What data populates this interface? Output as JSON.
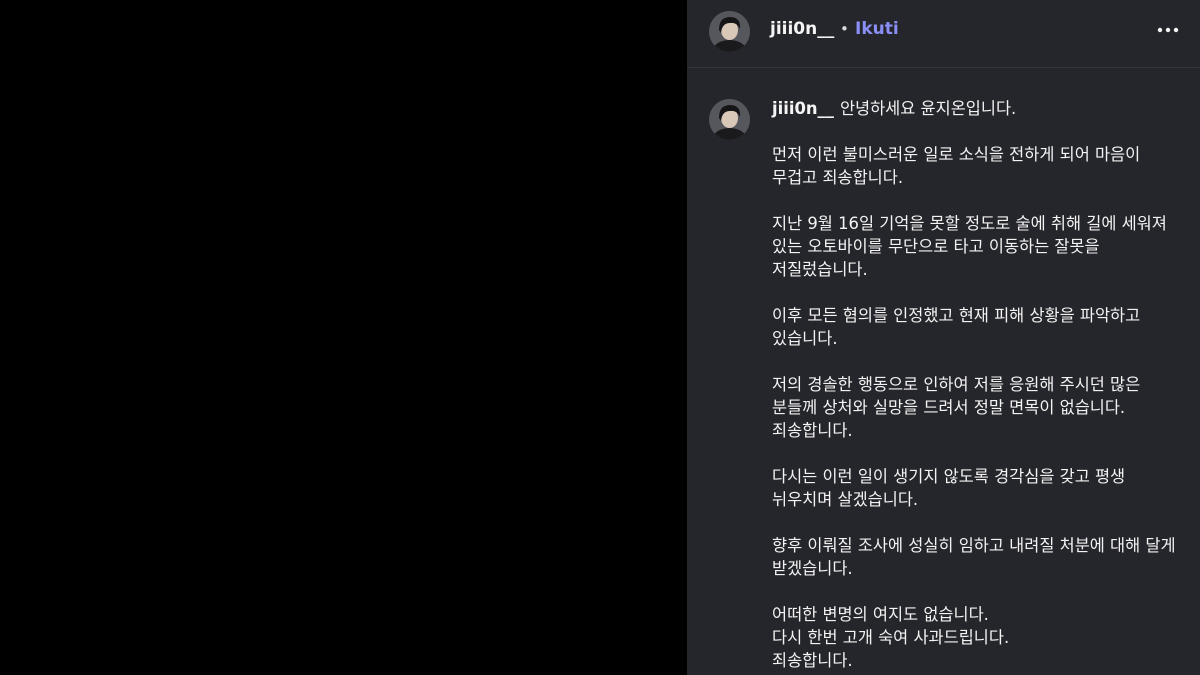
{
  "header": {
    "username": "jiii0n__",
    "separator": "•",
    "follow_label": "Ikuti",
    "avatar_icon": "profile-photo",
    "more_icon": "more-horizontal-icon"
  },
  "caption": {
    "username": "jiii0n__",
    "first_line": "안녕하세요 윤지온입니다.",
    "paragraphs": [
      "먼저 이런 불미스러운 일로 소식을 전하게 되어 마음이 무겁고 죄송합니다.",
      "지난 9월 16일 기억을 못할 정도로 술에 취해 길에 세워져 있는 오토바이를 무단으로 타고 이동하는 잘못을 저질렀습니다.",
      "이후 모든 혐의를 인정했고 현재 피해 상황을 파악하고 있습니다.",
      "저의 경솔한 행동으로 인하여 저를 응원해 주시던 많은 분들께 상처와 실망을 드려서 정말 면목이 없습니다. 죄송합니다.",
      "다시는 이런 일이 생기지 않도록 경각심을 갖고 평생 뉘우치며 살겠습니다.",
      "향후 이뤄질 조사에 성실히 임하고 내려질 처분에 대해 달게 받겠습니다.",
      "어떠한 변명의 여지도 없습니다.\n다시 한번 고개 숙여 사과드립니다.\n죄송합니다."
    ]
  },
  "colors": {
    "panel_background": "#25262b",
    "media_background": "#000000",
    "follow_accent": "#8a8ff5",
    "text": "#f3f3f3"
  }
}
